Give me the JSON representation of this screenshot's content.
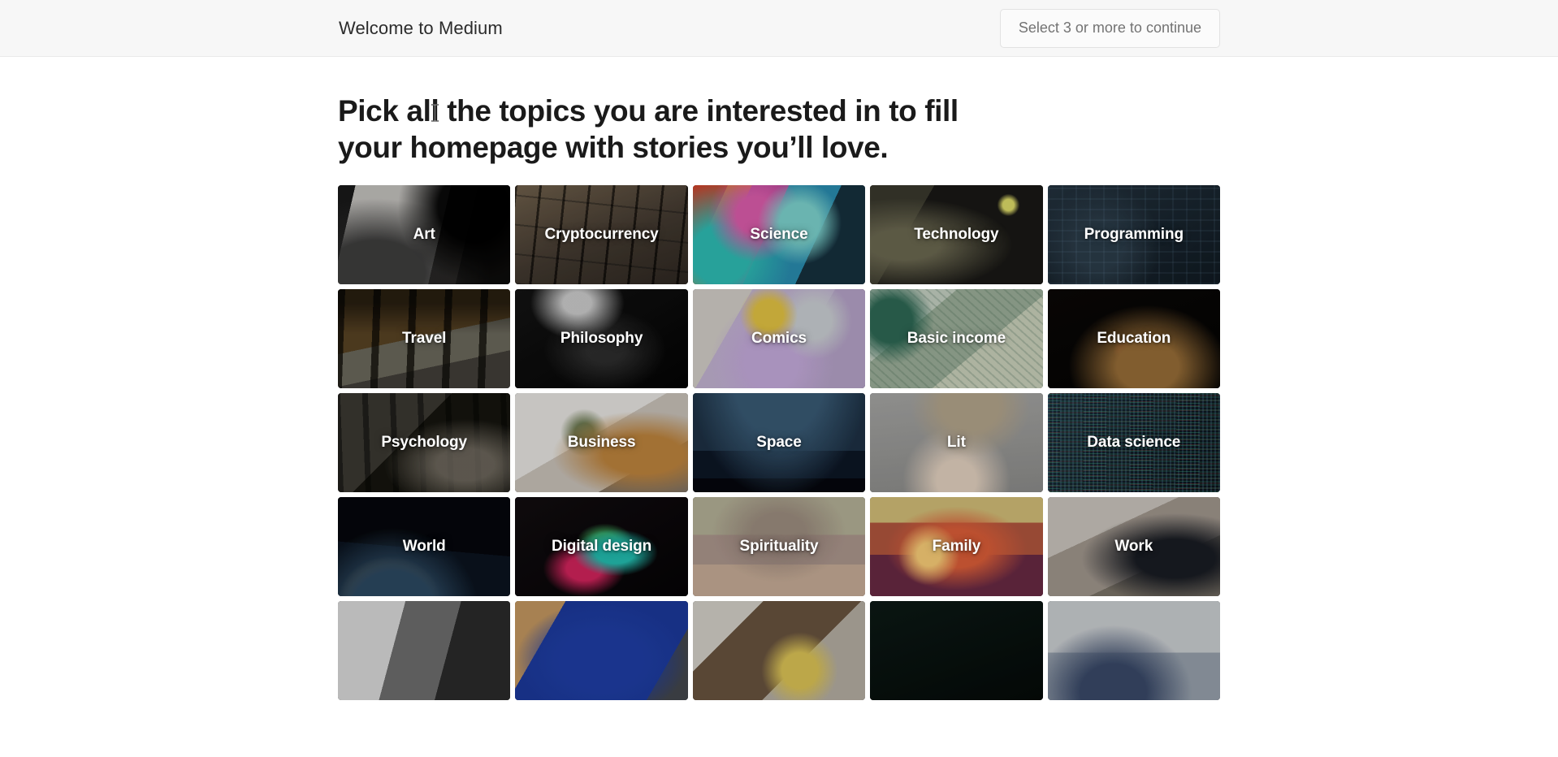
{
  "header": {
    "brand_title": "Welcome to Medium",
    "continue_button_label": "Select 3 or more to continue",
    "background_color": "#f7f7f7",
    "border_color": "#eaeaea"
  },
  "main": {
    "heading": "Pick all the topics you are interested in to fill your homepage with stories you’ll love.",
    "heading_line_1": "Pick all the topics you are interested in to fill your homepage",
    "heading_line_2": "with stories you’ll love.",
    "heading_color": "#1a1a1a"
  },
  "topics": {
    "columns": 5,
    "tiles": [
      {
        "label": "Art",
        "art": "bg-art",
        "row": 1,
        "col": 1,
        "selected": false
      },
      {
        "label": "Cryptocurrency",
        "art": "bg-crypto",
        "row": 1,
        "col": 2,
        "selected": false
      },
      {
        "label": "Science",
        "art": "bg-science",
        "row": 1,
        "col": 3,
        "selected": false
      },
      {
        "label": "Technology",
        "art": "bg-tech",
        "row": 1,
        "col": 4,
        "selected": false
      },
      {
        "label": "Programming",
        "art": "bg-prog",
        "row": 1,
        "col": 5,
        "selected": false
      },
      {
        "label": "Travel",
        "art": "bg-travel",
        "row": 2,
        "col": 1,
        "selected": false
      },
      {
        "label": "Philosophy",
        "art": "bg-philosophy",
        "row": 2,
        "col": 2,
        "selected": false
      },
      {
        "label": "Comics",
        "art": "bg-comics",
        "row": 2,
        "col": 3,
        "selected": false
      },
      {
        "label": "Basic income",
        "art": "bg-basicincome",
        "row": 2,
        "col": 4,
        "selected": false
      },
      {
        "label": "Education",
        "art": "bg-education",
        "row": 2,
        "col": 5,
        "selected": false
      },
      {
        "label": "Psychology",
        "art": "bg-psychology",
        "row": 3,
        "col": 1,
        "selected": false
      },
      {
        "label": "Business",
        "art": "bg-business",
        "row": 3,
        "col": 2,
        "selected": false
      },
      {
        "label": "Space",
        "art": "bg-space",
        "row": 3,
        "col": 3,
        "selected": false
      },
      {
        "label": "Lit",
        "art": "bg-lit",
        "row": 3,
        "col": 4,
        "selected": false
      },
      {
        "label": "Data science",
        "art": "bg-datascience",
        "row": 3,
        "col": 5,
        "selected": false
      },
      {
        "label": "World",
        "art": "bg-world",
        "row": 4,
        "col": 1,
        "selected": false
      },
      {
        "label": "Digital design",
        "art": "bg-digitaldesign",
        "row": 4,
        "col": 2,
        "selected": false
      },
      {
        "label": "Spirituality",
        "art": "bg-spirituality",
        "row": 4,
        "col": 3,
        "selected": false
      },
      {
        "label": "Family",
        "art": "bg-family",
        "row": 4,
        "col": 4,
        "selected": false
      },
      {
        "label": "Work",
        "art": "bg-work",
        "row": 4,
        "col": 5,
        "selected": false
      },
      {
        "label": "",
        "art": "bg-r5a",
        "row": 5,
        "col": 1,
        "selected": false,
        "clipped": true
      },
      {
        "label": "",
        "art": "bg-r5b",
        "row": 5,
        "col": 2,
        "selected": false,
        "clipped": true
      },
      {
        "label": "",
        "art": "bg-r5c",
        "row": 5,
        "col": 3,
        "selected": false,
        "clipped": true
      },
      {
        "label": "",
        "art": "bg-r5d",
        "row": 5,
        "col": 4,
        "selected": false,
        "clipped": true
      },
      {
        "label": "",
        "art": "bg-r5e",
        "row": 5,
        "col": 5,
        "selected": false,
        "clipped": true
      }
    ]
  }
}
